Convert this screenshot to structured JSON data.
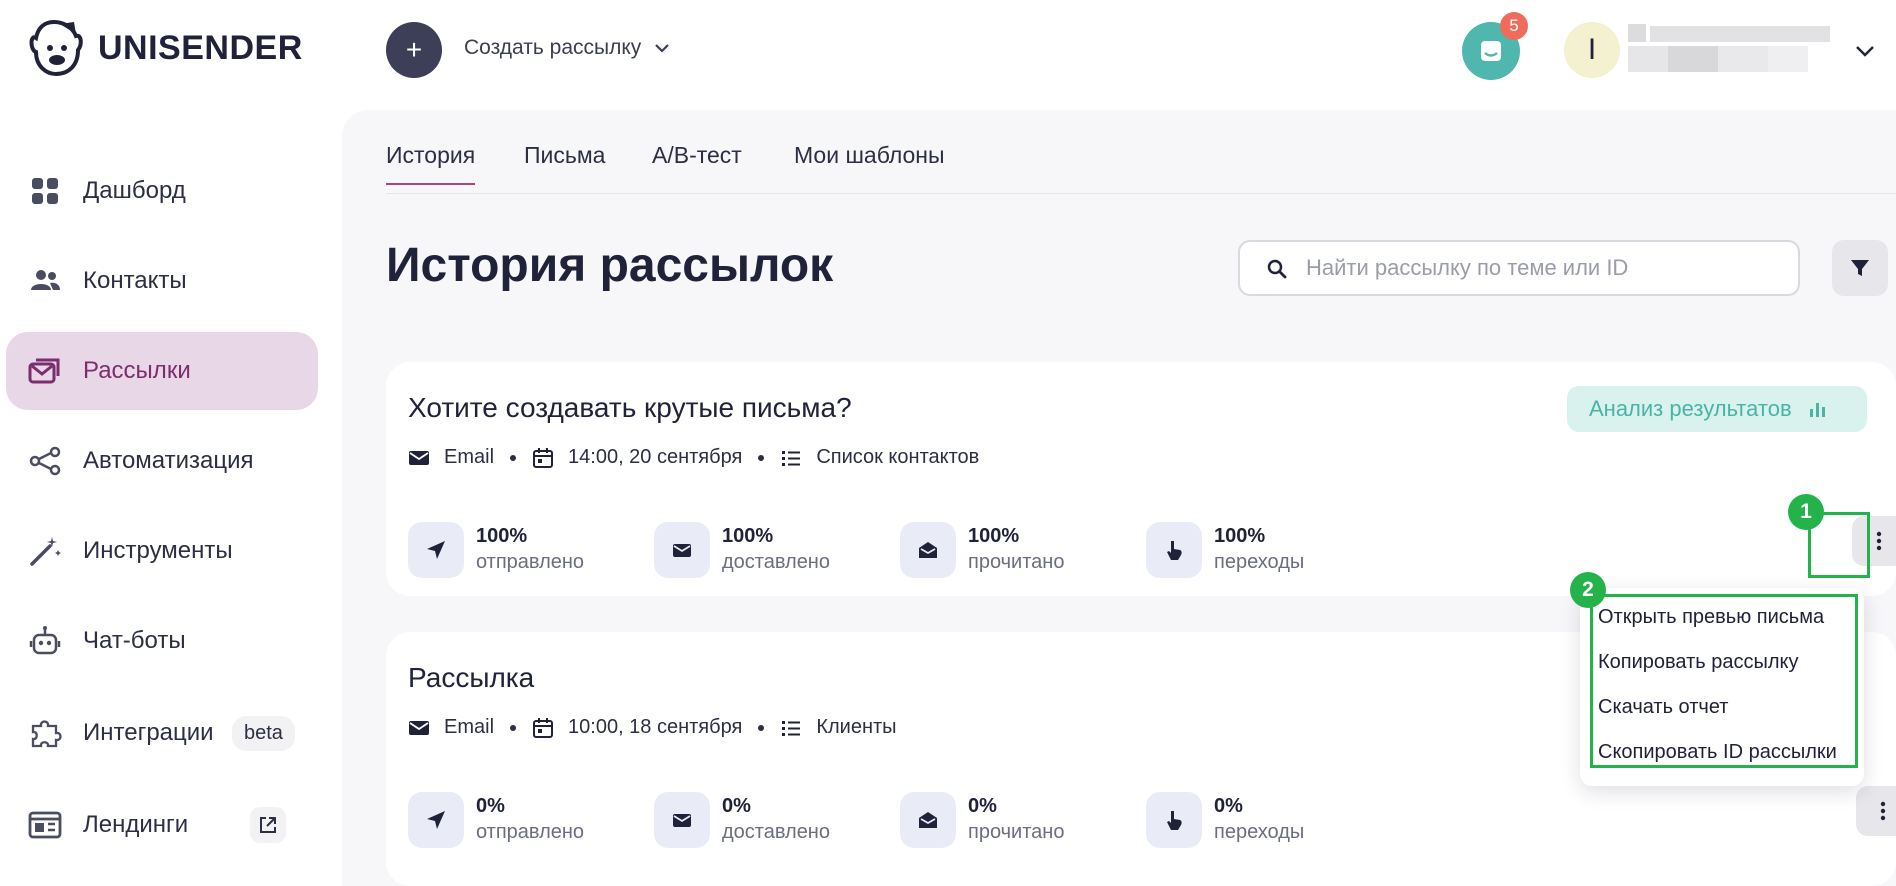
{
  "brand": {
    "name": "UNISENDER"
  },
  "topbar": {
    "create_label": "Создать рассылку",
    "chat_badge": "5",
    "avatar_initial": "I"
  },
  "sidebar": {
    "items": [
      {
        "label": "Дашборд",
        "icon": "dashboard-icon"
      },
      {
        "label": "Контакты",
        "icon": "contacts-icon"
      },
      {
        "label": "Рассылки",
        "icon": "mail-stack-icon",
        "active": true
      },
      {
        "label": "Автоматизация",
        "icon": "automation-icon"
      },
      {
        "label": "Инструменты",
        "icon": "magic-wand-icon"
      },
      {
        "label": "Чат-боты",
        "icon": "robot-icon"
      },
      {
        "label": "Интеграции",
        "icon": "puzzle-icon",
        "badge": "beta"
      },
      {
        "label": "Лендинги",
        "icon": "landing-icon"
      }
    ]
  },
  "tabs": [
    "История",
    "Письма",
    "A/B-тест",
    "Мои шаблоны"
  ],
  "page": {
    "title": "История рассылок",
    "search_placeholder": "Найти рассылку по теме или ID"
  },
  "campaigns": [
    {
      "title": "Хотите создавать крутые письма?",
      "channel": "Email",
      "datetime": "14:00, 20 сентября",
      "list": "Список контактов",
      "analysis_label": "Анализ результатов",
      "stats": [
        {
          "value": "100%",
          "label": "отправлено"
        },
        {
          "value": "100%",
          "label": "доставлено"
        },
        {
          "value": "100%",
          "label": "прочитано"
        },
        {
          "value": "100%",
          "label": "переходы"
        }
      ]
    },
    {
      "title": "Рассылка",
      "channel": "Email",
      "datetime": "10:00, 18 сентября",
      "list": "Клиенты",
      "stats": [
        {
          "value": "0%",
          "label": "отправлено"
        },
        {
          "value": "0%",
          "label": "доставлено"
        },
        {
          "value": "0%",
          "label": "прочитано"
        },
        {
          "value": "0%",
          "label": "переходы"
        }
      ]
    }
  ],
  "dropdown": {
    "items": [
      "Открыть превью письма",
      "Копировать рассылку",
      "Скачать отчет",
      "Скопировать ID рассылки"
    ]
  },
  "annotations": {
    "first": "1",
    "second": "2"
  },
  "colors": {
    "accent": "#7c2d6e",
    "active_bg": "#e8d7e6",
    "teal": "#4fb7ad",
    "highlight": "#24b34b"
  }
}
